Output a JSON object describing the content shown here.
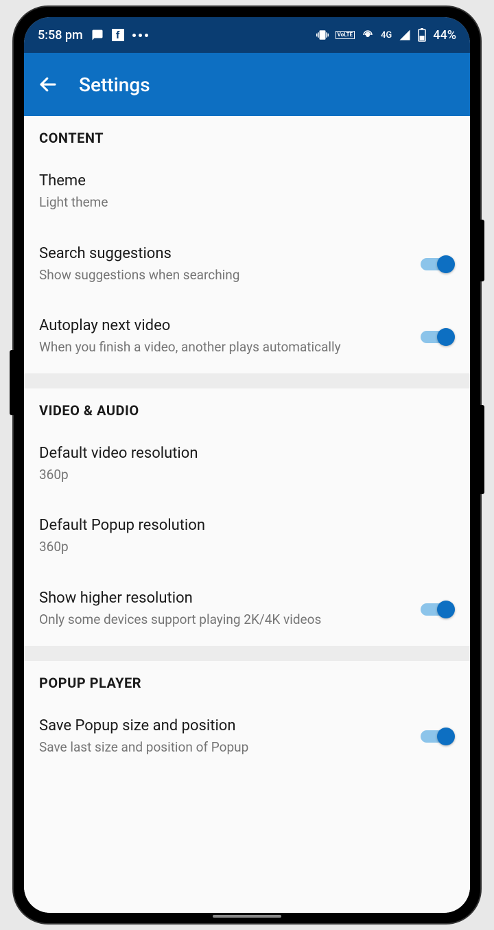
{
  "statusBar": {
    "time": "5:58 pm",
    "battery": "44%",
    "network": "4G"
  },
  "appBar": {
    "title": "Settings"
  },
  "sections": {
    "content": {
      "header": "CONTENT",
      "theme": {
        "title": "Theme",
        "subtitle": "Light theme"
      },
      "searchSuggestions": {
        "title": "Search suggestions",
        "subtitle": "Show suggestions when searching"
      },
      "autoplay": {
        "title": "Autoplay next video",
        "subtitle": "When you finish a video, another plays automatically"
      }
    },
    "videoAudio": {
      "header": "VIDEO & AUDIO",
      "defaultVideo": {
        "title": "Default video resolution",
        "subtitle": "360p"
      },
      "defaultPopup": {
        "title": "Default Popup resolution",
        "subtitle": "360p"
      },
      "higherRes": {
        "title": "Show higher resolution",
        "subtitle": "Only some devices support playing 2K/4K videos"
      }
    },
    "popupPlayer": {
      "header": "POPUP PLAYER",
      "savePopup": {
        "title": "Save Popup size and position",
        "subtitle": "Save last size and position of Popup"
      }
    }
  }
}
